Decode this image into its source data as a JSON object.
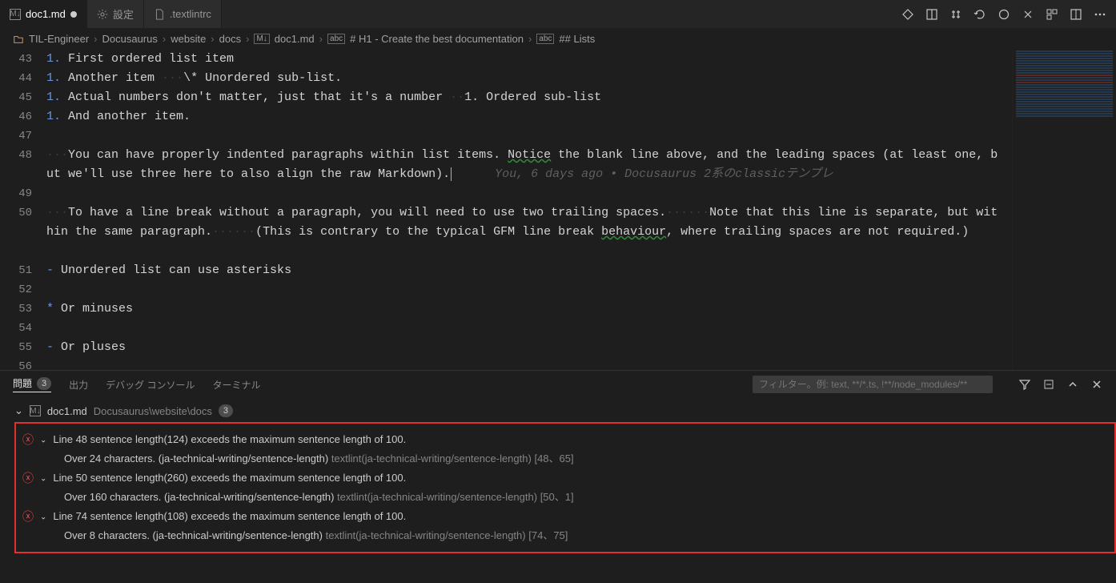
{
  "tabs": [
    {
      "icon": "M↓",
      "label": "doc1.md",
      "modified": true
    },
    {
      "icon": "⚙",
      "label": "設定"
    },
    {
      "icon": "📄",
      "label": ".textlintrc"
    }
  ],
  "breadcrumb": {
    "items": [
      {
        "icon": "",
        "text": "TIL-Engineer"
      },
      {
        "text": "Docusaurus"
      },
      {
        "text": "website"
      },
      {
        "text": "docs"
      },
      {
        "icon": "M↓",
        "text": "doc1.md"
      },
      {
        "icon": "abc",
        "text": "# H1 - Create the best documentation"
      },
      {
        "icon": "abc",
        "text": "## Lists"
      }
    ]
  },
  "gitlens": "You, 6 days ago • Docusaurus 2系のclassicテンプレ",
  "lines": [
    {
      "n": 43,
      "prefix": "1.",
      "text": "First ordered list item"
    },
    {
      "n": 44,
      "prefix": "1.",
      "text": "Another item ",
      "ws": "···",
      "after": "\\* Unordered sub-list."
    },
    {
      "n": 45,
      "prefix": "1.",
      "text": "Actual numbers don't matter, just that it's a number ",
      "ws": "··",
      "after": "1. Ordered sub-list"
    },
    {
      "n": 46,
      "prefix": "1.",
      "text": "And another item."
    },
    {
      "n": 47,
      "blank": true
    },
    {
      "n": 48,
      "ws": "···",
      "wrap": "You can have properly indented paragraphs within list items. Notice the blank line above, and the leading spaces (at least one, but we'll use three here to also align the raw Markdown).",
      "cursor": true,
      "gitlens": true
    },
    {
      "n": 49,
      "blank": true
    },
    {
      "n": 50,
      "ws": "···",
      "wrap": "To have a line break without a paragraph, you will need to use two trailing spaces.······Note that this line is separate, but within the same paragraph.······(This is contrary to the typical GFM line break behaviour, where trailing spaces are not required.)"
    },
    {
      "n": 51,
      "blank": true
    },
    {
      "n": 52,
      "bullet": "-",
      "text": "Unordered list can use asterisks"
    },
    {
      "n": 53,
      "blank": true
    },
    {
      "n": 54,
      "bullet": "*",
      "text": "Or minuses"
    },
    {
      "n": 55,
      "blank": true
    },
    {
      "n": 56,
      "bullet": "-",
      "text": "Or pluses"
    }
  ],
  "panel": {
    "tabs": {
      "problems": "問題",
      "output": "出力",
      "debug": "デバッグ コンソール",
      "terminal": "ターミナル"
    },
    "badge": "3",
    "filter_placeholder": "フィルター。例: text, **/*.ts, !**/node_modules/**",
    "file": {
      "name": "doc1.md",
      "path": "Docusaurus\\website\\docs",
      "count": "3"
    },
    "problems": [
      {
        "msg": "Line 48 sentence length(124) exceeds the maximum sentence length of 100.",
        "sub": "Over 24 characters. (ja-technical-writing/sentence-length)",
        "src": "textlint(ja-technical-writing/sentence-length)",
        "loc": "[48、65]"
      },
      {
        "msg": "Line 50 sentence length(260) exceeds the maximum sentence length of 100.",
        "sub": "Over 160 characters. (ja-technical-writing/sentence-length)",
        "src": "textlint(ja-technical-writing/sentence-length)",
        "loc": "[50、1]"
      },
      {
        "msg": "Line 74 sentence length(108) exceeds the maximum sentence length of 100.",
        "sub": "Over 8 characters. (ja-technical-writing/sentence-length)",
        "src": "textlint(ja-technical-writing/sentence-length)",
        "loc": "[74、75]"
      }
    ]
  },
  "icons": {
    "md": "M↓",
    "gear": "⚙",
    "file": "▢",
    "chevron": "›",
    "abc": "abc"
  }
}
